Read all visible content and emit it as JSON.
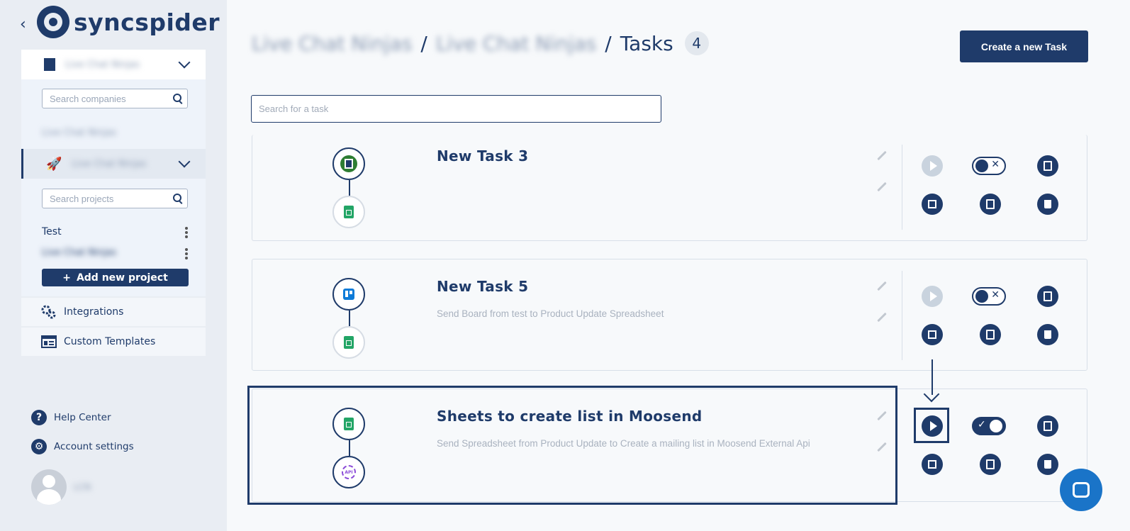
{
  "brand": {
    "name": "syncspider"
  },
  "sidebar": {
    "company": {
      "name": "Live Chat Ninjas",
      "search_placeholder": "Search companies",
      "list": [
        "Live Chat Ninjas"
      ]
    },
    "project": {
      "name": "Live Chat Ninjas",
      "search_placeholder": "Search projects"
    },
    "projects": [
      {
        "label": "Test"
      },
      {
        "label": "Live Chat Ninjas"
      }
    ],
    "add_project_label": "Add new project",
    "nav": [
      {
        "label": "Integrations",
        "icon": "gears-icon"
      },
      {
        "label": "Custom Templates",
        "icon": "template-icon"
      }
    ],
    "footer": [
      {
        "label": "Help Center",
        "icon": "question-icon"
      },
      {
        "label": "Account settings",
        "icon": "gear-icon"
      }
    ],
    "user": {
      "name": "LCN"
    }
  },
  "header": {
    "breadcrumb": [
      "Live Chat Ninjas",
      "Live Chat Ninjas"
    ],
    "separator": "/",
    "title": "Tasks",
    "count": "4",
    "create_label": "Create a new Task"
  },
  "search": {
    "placeholder": "Search for a task"
  },
  "tasks": [
    {
      "title": "New Task 3",
      "description": "",
      "enabled": false,
      "source_icon": "doc-icon",
      "target_icon": "google-sheets-icon"
    },
    {
      "title": "New Task 5",
      "description": "Send Board from test to Product Update Spreadsheet",
      "enabled": false,
      "source_icon": "trello-icon",
      "target_icon": "google-sheets-icon"
    },
    {
      "title": "Sheets to create list in Moosend",
      "description": "Send Spreadsheet from Product Update to Create a mailing list in Moosend External Api",
      "enabled": true,
      "source_icon": "google-sheets-icon",
      "target_icon": "api-icon"
    }
  ],
  "colors": {
    "primary": "#1f3b6a",
    "accent": "#1a74c8",
    "sheets": "#23a566"
  }
}
